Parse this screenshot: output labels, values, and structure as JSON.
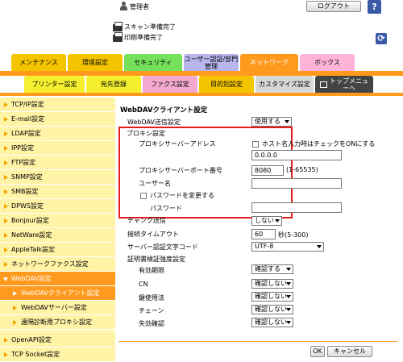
{
  "header": {
    "user_name": "管理者",
    "logout_label": "ログアウト",
    "help_label": "?",
    "scan_status": "スキャン準備完了",
    "print_status": "印刷準備完了"
  },
  "main_tabs": [
    {
      "label": "メンテナンス"
    },
    {
      "label": "環境設定"
    },
    {
      "label": "セキュリティ"
    },
    {
      "label": "ユーザー認証/部門管理"
    },
    {
      "label": "ネットワーク"
    },
    {
      "label": "ボックス"
    }
  ],
  "sub_tabs": [
    {
      "label": "プリンター設定"
    },
    {
      "label": "宛先登録"
    },
    {
      "label": "ファクス設定"
    },
    {
      "label": "目的別設定"
    },
    {
      "label": "カスタマイズ設定"
    },
    {
      "label": "トップメニューへ"
    }
  ],
  "sidebar": {
    "items": [
      {
        "label": "TCP/IP設定"
      },
      {
        "label": "E-mail設定"
      },
      {
        "label": "LDAP設定"
      },
      {
        "label": "IPP設定"
      },
      {
        "label": "FTP設定"
      },
      {
        "label": "SNMP設定"
      },
      {
        "label": "SMB設定"
      },
      {
        "label": "DPWS設定"
      },
      {
        "label": "Bonjour設定"
      },
      {
        "label": "NetWare設定"
      },
      {
        "label": "AppleTalk設定"
      },
      {
        "label": "ネットワークファクス設定"
      },
      {
        "label": "WebDAV設定"
      },
      {
        "label": "WebDAVクライアント設定"
      },
      {
        "label": "WebDAVサーバー設定"
      },
      {
        "label": "遠隔診断用プロキシ設定"
      },
      {
        "label": "OpenAPI設定"
      },
      {
        "label": "TCP Socket設定"
      }
    ]
  },
  "form": {
    "title": "WebDAVクライアント設定",
    "webdav_send_label": "WebDAV送信設定",
    "webdav_send_value": "使用する",
    "proxy_label": "プロキシ設定",
    "proxy_address_label": "プロキシサーバーアドレス",
    "hostname_check_label": "ホスト名入力時はチェックをONにする",
    "proxy_address_value": "0.0.0.0",
    "proxy_port_label": "プロキシサーバーポート番号",
    "proxy_port_value": "8080",
    "proxy_port_range": "(1-65535)",
    "username_label": "ユーザー名",
    "username_value": "",
    "change_password_label": "パスワードを変更する",
    "password_label": "パスワード",
    "password_value": "",
    "chunk_label": "チャンク送信",
    "chunk_value": "しない",
    "timeout_label": "接続タイムアウト",
    "timeout_value": "60",
    "timeout_unit": "秒(5-300)",
    "server_charset_label": "サーバー認証文字コード",
    "server_charset_value": "UTF-8",
    "cert_level_label": "証明書検証強度設定",
    "validity_label": "有効期限",
    "validity_value": "確認する",
    "cn_label": "CN",
    "cn_value": "確認しない",
    "key_usage_label": "鍵使用法",
    "key_usage_value": "確認しない",
    "chain_label": "チェーン",
    "chain_value": "確認しない",
    "revocation_label": "失効確認",
    "revocation_value": "確認しない",
    "ok_label": "OK",
    "cancel_label": "キャンセル"
  },
  "colors": {
    "accent_orange": "#ff9a1e",
    "highlight_red": "#e31b1b",
    "sidebar_bg": "#fff3a6"
  }
}
